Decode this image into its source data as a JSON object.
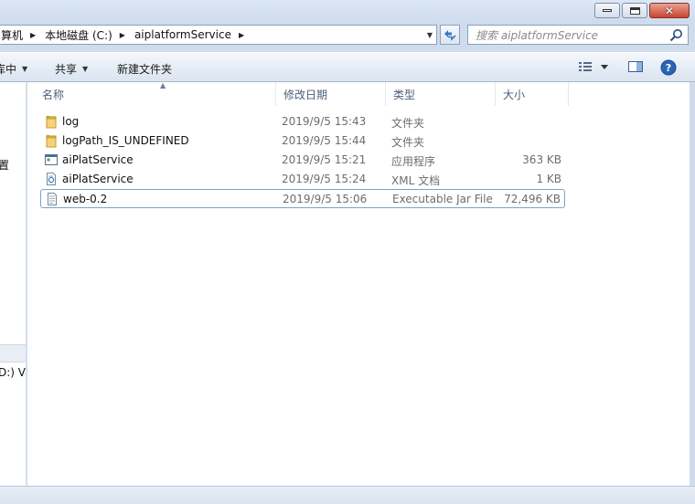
{
  "window": {
    "controls": [
      "minimize",
      "maximize",
      "close"
    ]
  },
  "address": {
    "crumbs": [
      "算机",
      "本地磁盘 (C:)",
      "aiplatformService"
    ]
  },
  "search": {
    "placeholder": "搜索 aiplatformService"
  },
  "toolbar": {
    "organize": "库中",
    "share": "共享",
    "new_folder": "新建文件夹"
  },
  "nav": {
    "item1": "置",
    "item2": "D:) VM"
  },
  "columns": {
    "name": "名称",
    "date": "修改日期",
    "type": "类型",
    "size": "大小"
  },
  "files": [
    {
      "name": "log",
      "date": "2019/9/5 15:43",
      "type": "文件夹",
      "size": "",
      "icon": "folder-icon"
    },
    {
      "name": "logPath_IS_UNDEFINED",
      "date": "2019/9/5 15:44",
      "type": "文件夹",
      "size": "",
      "icon": "folder-icon"
    },
    {
      "name": "aiPlatService",
      "date": "2019/9/5 15:21",
      "type": "应用程序",
      "size": "363 KB",
      "icon": "exe-icon"
    },
    {
      "name": "aiPlatService",
      "date": "2019/9/5 15:24",
      "type": "XML 文档",
      "size": "1 KB",
      "icon": "xml-icon"
    },
    {
      "name": "web-0.2",
      "date": "2019/9/5 15:06",
      "type": "Executable Jar File",
      "size": "72,496 KB",
      "icon": "jar-icon"
    }
  ],
  "colors": {
    "chrome": "#cfdcec",
    "selection_border": "#7da2ce",
    "header_text": "#4b5e78"
  }
}
